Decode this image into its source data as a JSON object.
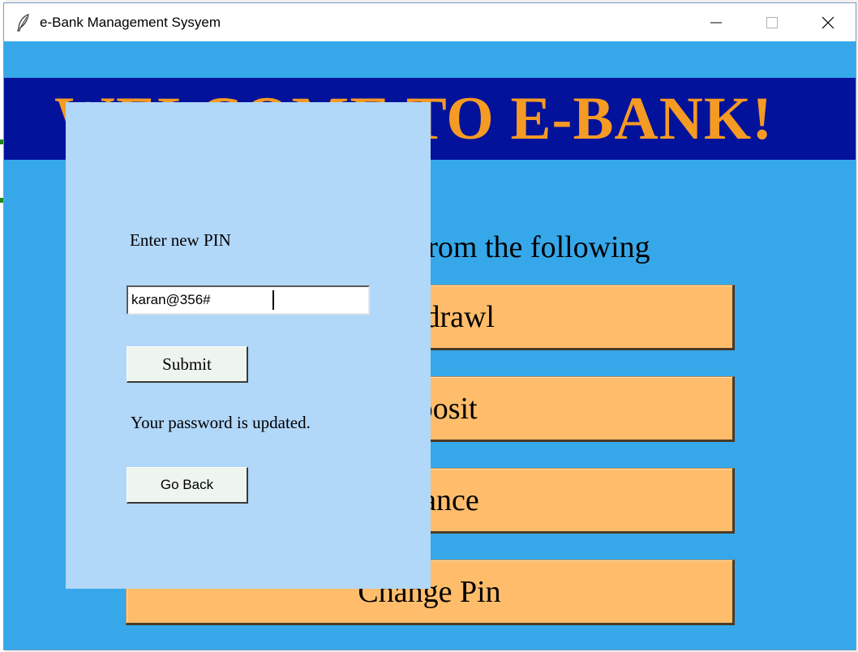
{
  "window": {
    "title": "e-Bank Management Sysyem"
  },
  "banner": {
    "text": "WELCOME TO E-BANK!"
  },
  "main": {
    "prompt": "Select an option from the following",
    "options": [
      {
        "label": "Withdrawl"
      },
      {
        "label": "Deposit"
      },
      {
        "label": "Balance"
      },
      {
        "label": "Change Pin"
      }
    ]
  },
  "pin_dialog": {
    "label": "Enter new PIN",
    "input_value": "karan@356#",
    "submit_label": "Submit",
    "status_message": "Your password is updated.",
    "back_label": "Go Back"
  },
  "colors": {
    "background": "#36a8ea",
    "banner_bg": "#03129a",
    "banner_text": "#f59a23",
    "option_button": "#ffbd6b",
    "panel_bg": "#b1d7f9"
  }
}
